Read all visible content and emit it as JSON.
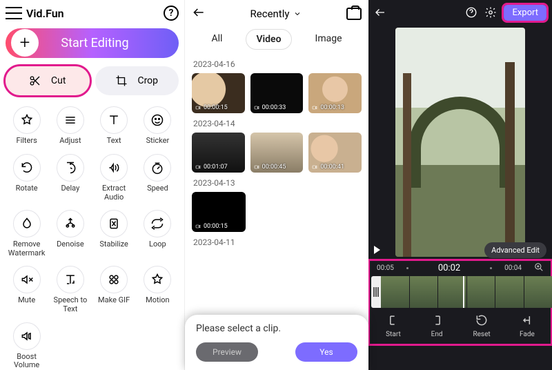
{
  "p1": {
    "brand": "Vid.Fun",
    "start": "Start Editing",
    "cut": "Cut",
    "crop": "Crop",
    "tools": [
      {
        "id": "filters",
        "label": "Filters"
      },
      {
        "id": "adjust",
        "label": "Adjust"
      },
      {
        "id": "text",
        "label": "Text"
      },
      {
        "id": "sticker",
        "label": "Sticker"
      },
      {
        "id": "rotate",
        "label": "Rotate"
      },
      {
        "id": "delay",
        "label": "Delay"
      },
      {
        "id": "extract-audio",
        "label": "Extract Audio"
      },
      {
        "id": "speed",
        "label": "Speed"
      },
      {
        "id": "remove-watermark",
        "label": "Remove Watermark"
      },
      {
        "id": "denoise",
        "label": "Denoise"
      },
      {
        "id": "stabilize",
        "label": "Stabilize"
      },
      {
        "id": "loop",
        "label": "Loop"
      },
      {
        "id": "mute",
        "label": "Mute"
      },
      {
        "id": "speech-to-text",
        "label": "Speech to Text"
      },
      {
        "id": "make-gif",
        "label": "Make GIF"
      },
      {
        "id": "motion",
        "label": "Motion"
      },
      {
        "id": "boost-volume",
        "label": "Boost Volume"
      }
    ]
  },
  "p2": {
    "sort": "Recently",
    "tabs": [
      "All",
      "Video",
      "Image"
    ],
    "active_tab": "Video",
    "groups": [
      {
        "date": "2023-04-16",
        "items": [
          {
            "dur": "00:00:15"
          },
          {
            "dur": "00:00:33"
          },
          {
            "dur": "00:00:13"
          }
        ]
      },
      {
        "date": "2023-04-14",
        "items": [
          {
            "dur": "00:01:07"
          },
          {
            "dur": "00:00:45"
          },
          {
            "dur": "00:00:41"
          }
        ]
      },
      {
        "date": "2023-04-13",
        "items": [
          {
            "dur": "00:00:15"
          }
        ]
      },
      {
        "date": "2023-04-11",
        "items": []
      }
    ],
    "modal": {
      "msg": "Please select a clip.",
      "preview": "Preview",
      "yes": "Yes"
    }
  },
  "p3": {
    "export": "Export",
    "advanced": "Advanced Edit",
    "t_left": "00:05",
    "t_center": "00:02",
    "t_right": "00:04",
    "controls": [
      {
        "id": "start",
        "label": "Start"
      },
      {
        "id": "end",
        "label": "End"
      },
      {
        "id": "reset",
        "label": "Reset"
      },
      {
        "id": "fade",
        "label": "Fade"
      }
    ]
  }
}
